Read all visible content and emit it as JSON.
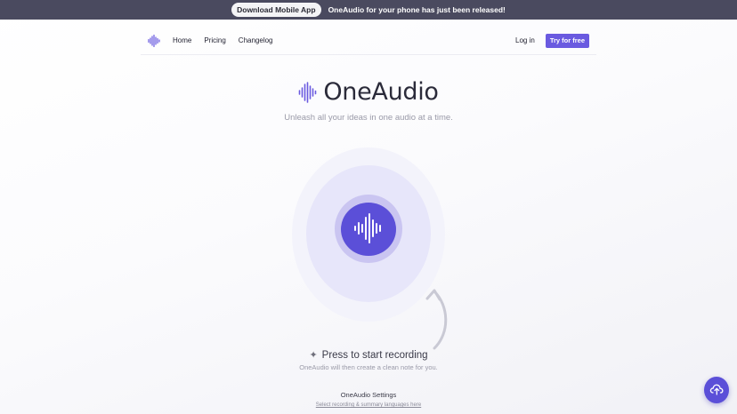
{
  "banner": {
    "button_label": "Download Mobile App",
    "message": "OneAudio for your phone has just been released!"
  },
  "nav": {
    "logo_icon": "waveform-icon",
    "links": [
      "Home",
      "Pricing",
      "Changelog"
    ],
    "login_label": "Log in",
    "cta_label": "Try for free"
  },
  "hero": {
    "title": "OneAudio",
    "tagline": "Unleash all your ideas in one audio at a time."
  },
  "recorder": {
    "button_icon": "waveform-icon",
    "prompt": "Press to start recording",
    "note": "OneAudio will then create a clean note for you."
  },
  "settings": {
    "title": "OneAudio Settings",
    "link_label": "Select recording & summary languages here"
  },
  "fab": {
    "icon": "upload-cloud-icon"
  },
  "colors": {
    "accent": "#5b4fd8",
    "banner_bg": "#4a4a5f",
    "cta_bg": "#6a5ae0"
  }
}
